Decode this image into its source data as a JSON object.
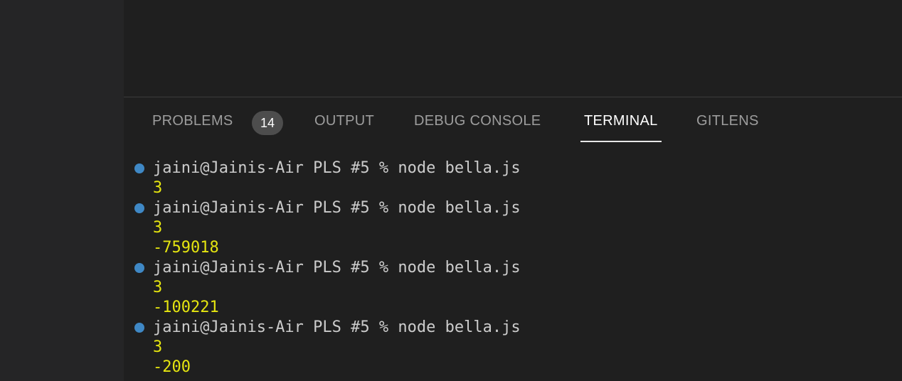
{
  "panel": {
    "tabs": [
      {
        "label": "PROBLEMS"
      },
      {
        "label": "OUTPUT"
      },
      {
        "label": "DEBUG CONSOLE"
      },
      {
        "label": "TERMINAL"
      },
      {
        "label": "GITLENS"
      }
    ],
    "problems_count": "14",
    "active_tab": "TERMINAL"
  },
  "terminal": {
    "lines": [
      {
        "type": "command",
        "text": "jaini@Jainis-Air PLS #5 % node bella.js"
      },
      {
        "type": "output",
        "text": "3"
      },
      {
        "type": "command",
        "text": "jaini@Jainis-Air PLS #5 % node bella.js"
      },
      {
        "type": "output",
        "text": "3"
      },
      {
        "type": "output",
        "text": "-759018"
      },
      {
        "type": "command",
        "text": "jaini@Jainis-Air PLS #5 % node bella.js"
      },
      {
        "type": "output",
        "text": "3"
      },
      {
        "type": "output",
        "text": "-100221"
      },
      {
        "type": "command",
        "text": "jaini@Jainis-Air PLS #5 % node bella.js"
      },
      {
        "type": "output",
        "text": "3"
      },
      {
        "type": "output",
        "text": "-200"
      }
    ]
  },
  "colors": {
    "background": "#1f1f1f",
    "sidebar": "#252526",
    "prompt_dot": "#3f88c5",
    "output_text": "#e5e510",
    "command_text": "#cccccc"
  },
  "icons": {
    "prompt_marker": "circle-dot-icon"
  }
}
